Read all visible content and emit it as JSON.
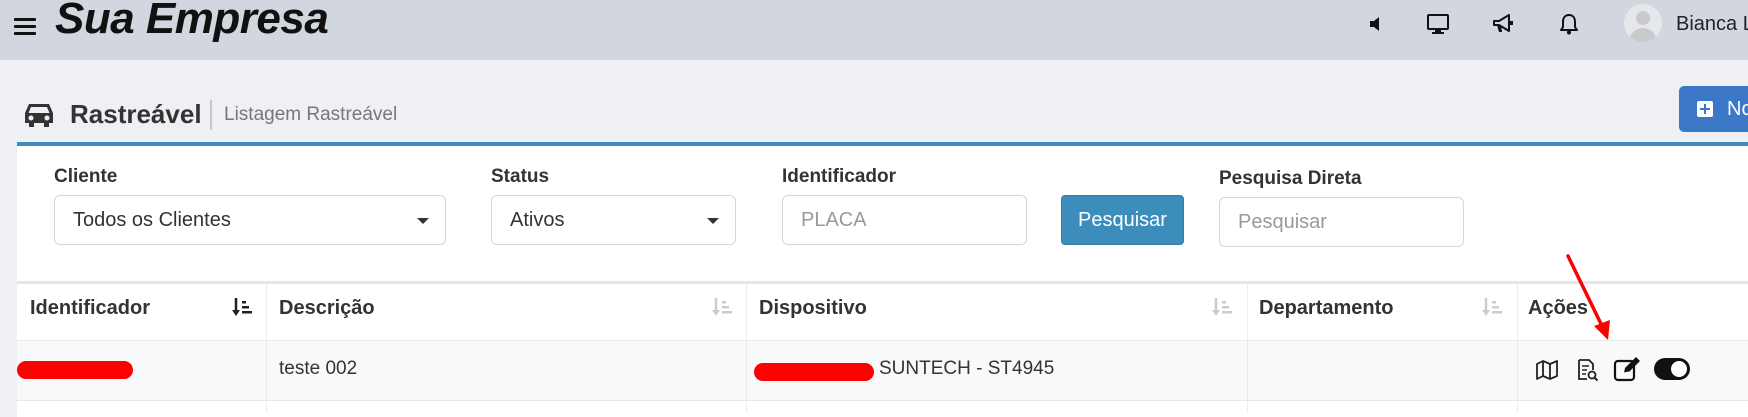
{
  "header": {
    "brand": "Sua Empresa",
    "icons": [
      "menu-icon",
      "volume-icon",
      "monitor-icon",
      "megaphone-icon",
      "bell-icon"
    ],
    "user_name": "Bianca L"
  },
  "page": {
    "title": "Rastreável",
    "subtitle": "Listagem Rastreável",
    "new_button_label": "No"
  },
  "filters": {
    "cliente_label": "Cliente",
    "cliente_value": "Todos os Clientes",
    "status_label": "Status",
    "status_value": "Ativos",
    "identificador_label": "Identificador",
    "identificador_placeholder": "PLACA",
    "search_button_label": "Pesquisar",
    "pesquisa_direta_label": "Pesquisa Direta",
    "pesquisa_direta_placeholder": "Pesquisar"
  },
  "table": {
    "columns": [
      "Identificador",
      "Descrição",
      "Dispositivo",
      "Departamento",
      "Ações"
    ],
    "rows": [
      {
        "identificador": "",
        "descricao": "teste 002",
        "dispositivo": "SUNTECH - ST4945",
        "departamento": "",
        "actions": [
          "map-icon",
          "details-icon",
          "edit-icon",
          "toggle-switch"
        ]
      }
    ]
  },
  "colors": {
    "topbar": "#d2d6de",
    "accent": "#3c8dbc",
    "new_button": "#3c78c8",
    "annotation_arrow": "#ff0000"
  }
}
